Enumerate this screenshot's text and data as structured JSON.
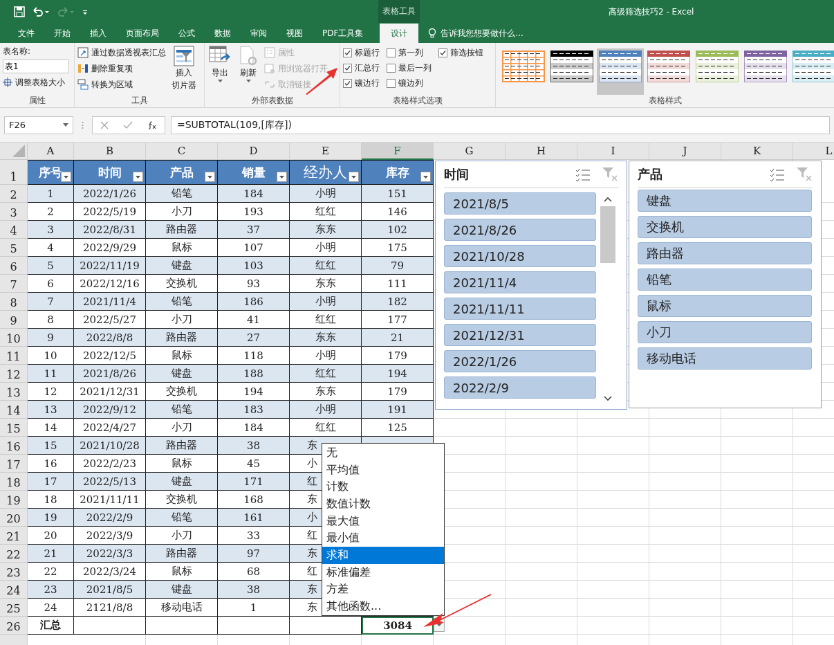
{
  "window": {
    "title": "高级筛选技巧2 - Excel",
    "contextual_tab": "表格工具"
  },
  "tabs": [
    {
      "label": "文件",
      "selected": false
    },
    {
      "label": "开始",
      "selected": false
    },
    {
      "label": "插入",
      "selected": false
    },
    {
      "label": "页面布局",
      "selected": false
    },
    {
      "label": "公式",
      "selected": false
    },
    {
      "label": "数据",
      "selected": false
    },
    {
      "label": "审阅",
      "selected": false
    },
    {
      "label": "视图",
      "selected": false
    },
    {
      "label": "PDF工具集",
      "selected": false
    },
    {
      "label": "设计",
      "selected": true
    }
  ],
  "tell_me": "告诉我您想要做什么...",
  "ribbon": {
    "properties": {
      "name_label": "表名称:",
      "name_value": "表1",
      "resize": "调整表格大小",
      "group": "属性"
    },
    "tools": {
      "items": [
        "通过数据透视表汇总",
        "删除重复项",
        "转换为区域"
      ],
      "slicer": [
        "插入",
        "切片器"
      ],
      "group": "工具"
    },
    "external": {
      "export": "导出",
      "refresh": "刷新",
      "small": [
        {
          "label": "属性",
          "disabled": true
        },
        {
          "label": "用浏览器打开",
          "disabled": true
        },
        {
          "label": "取消链接",
          "disabled": true
        }
      ],
      "group": "外部表数据"
    },
    "options": {
      "checks": [
        [
          {
            "label": "标题行",
            "checked": true
          },
          {
            "label": "汇总行",
            "checked": true
          },
          {
            "label": "镶边行",
            "checked": true
          }
        ],
        [
          {
            "label": "第一列",
            "checked": false
          },
          {
            "label": "最后一列",
            "checked": false
          },
          {
            "label": "镶边列",
            "checked": false
          }
        ],
        [
          {
            "label": "筛选按钮",
            "checked": true
          }
        ]
      ],
      "group": "表格样式选项"
    },
    "styles": {
      "swatches": [
        {
          "kind": "grid",
          "color": "#f79646",
          "selected": false
        },
        {
          "kind": "banded",
          "color": "#000000",
          "selected": false
        },
        {
          "kind": "banded",
          "color": "#4f81bd",
          "selected": true
        },
        {
          "kind": "banded",
          "color": "#c0504d",
          "selected": false
        },
        {
          "kind": "banded",
          "color": "#9bbb59",
          "selected": false
        },
        {
          "kind": "banded",
          "color": "#8064a2",
          "selected": false
        },
        {
          "kind": "banded",
          "color": "#4bacc6",
          "selected": false
        }
      ],
      "group": "表格样式"
    }
  },
  "formula_bar": {
    "name_box": "F26",
    "formula": "=SUBTOTAL(109,[库存])"
  },
  "columns": [
    {
      "label": "A",
      "selected": false
    },
    {
      "label": "B",
      "selected": false
    },
    {
      "label": "C",
      "selected": false
    },
    {
      "label": "D",
      "selected": false
    },
    {
      "label": "E",
      "selected": false
    },
    {
      "label": "F",
      "selected": true
    },
    {
      "label": "G",
      "selected": false
    },
    {
      "label": "H",
      "selected": false
    },
    {
      "label": "I",
      "selected": false
    },
    {
      "label": "J",
      "selected": false
    },
    {
      "label": "K",
      "selected": false
    },
    {
      "label": "L",
      "selected": false
    }
  ],
  "row_headers": [
    "1",
    "2",
    "3",
    "4",
    "5",
    "6",
    "7",
    "8",
    "9",
    "10",
    "11",
    "12",
    "13",
    "14",
    "15",
    "16",
    "17",
    "18",
    "19",
    "20",
    "21",
    "22",
    "23",
    "24",
    "25",
    "26"
  ],
  "table": {
    "headers": [
      "序号",
      "时间",
      "产品",
      "销量",
      "经办人",
      "库存"
    ],
    "rows": [
      [
        "1",
        "2022/1/26",
        "铅笔",
        "184",
        "小明",
        "151"
      ],
      [
        "2",
        "2022/5/19",
        "小刀",
        "193",
        "红红",
        "146"
      ],
      [
        "3",
        "2022/8/31",
        "路由器",
        "37",
        "东东",
        "102"
      ],
      [
        "4",
        "2022/9/29",
        "鼠标",
        "107",
        "小明",
        "175"
      ],
      [
        "5",
        "2022/11/19",
        "键盘",
        "103",
        "红红",
        "79"
      ],
      [
        "6",
        "2022/12/16",
        "交换机",
        "93",
        "东东",
        "111"
      ],
      [
        "7",
        "2021/11/4",
        "铅笔",
        "186",
        "小明",
        "182"
      ],
      [
        "8",
        "2022/5/27",
        "小刀",
        "41",
        "红红",
        "177"
      ],
      [
        "9",
        "2022/8/8",
        "路由器",
        "27",
        "东东",
        "21"
      ],
      [
        "10",
        "2022/12/5",
        "鼠标",
        "118",
        "小明",
        "179"
      ],
      [
        "11",
        "2021/8/26",
        "键盘",
        "188",
        "红红",
        "194"
      ],
      [
        "12",
        "2021/12/31",
        "交换机",
        "194",
        "东东",
        "179"
      ],
      [
        "13",
        "2022/9/12",
        "铅笔",
        "183",
        "小明",
        "191"
      ],
      [
        "14",
        "2022/4/27",
        "小刀",
        "184",
        "红红",
        "125"
      ],
      [
        "15",
        "2021/10/28",
        "路由器",
        "38",
        "东",
        ""
      ],
      [
        "16",
        "2022/2/23",
        "鼠标",
        "45",
        "小",
        ""
      ],
      [
        "17",
        "2022/5/13",
        "键盘",
        "171",
        "红",
        ""
      ],
      [
        "18",
        "2021/11/11",
        "交换机",
        "168",
        "东",
        ""
      ],
      [
        "19",
        "2022/2/9",
        "铅笔",
        "161",
        "小",
        ""
      ],
      [
        "20",
        "2022/3/9",
        "小刀",
        "33",
        "红",
        ""
      ],
      [
        "21",
        "2022/3/3",
        "路由器",
        "97",
        "东",
        ""
      ],
      [
        "22",
        "2022/3/24",
        "鼠标",
        "68",
        "红",
        ""
      ],
      [
        "23",
        "2021/8/5",
        "键盘",
        "38",
        "东",
        ""
      ],
      [
        "24",
        "2121/8/8",
        "移动电话",
        "1",
        "东",
        ""
      ]
    ],
    "total_label": "汇总",
    "total_value": "3084"
  },
  "slicers": [
    {
      "title": "时间",
      "items": [
        {
          "label": "2021/8/5",
          "selected": true
        },
        {
          "label": "2021/8/26",
          "selected": true
        },
        {
          "label": "2021/10/28",
          "selected": true
        },
        {
          "label": "2021/11/4",
          "selected": true
        },
        {
          "label": "2021/11/11",
          "selected": true
        },
        {
          "label": "2021/12/31",
          "selected": true
        },
        {
          "label": "2022/1/26",
          "selected": true
        },
        {
          "label": "2022/2/9",
          "selected": true
        }
      ],
      "scrollbar": true
    },
    {
      "title": "产品",
      "items": [
        {
          "label": "键盘",
          "selected": true
        },
        {
          "label": "交换机",
          "selected": true
        },
        {
          "label": "路由器",
          "selected": true
        },
        {
          "label": "铅笔",
          "selected": true
        },
        {
          "label": "鼠标",
          "selected": true
        },
        {
          "label": "小刀",
          "selected": true
        },
        {
          "label": "移动电话",
          "selected": true
        }
      ],
      "scrollbar": false
    }
  ],
  "total_menu": [
    {
      "label": "无",
      "selected": false
    },
    {
      "label": "平均值",
      "selected": false
    },
    {
      "label": "计数",
      "selected": false
    },
    {
      "label": "数值计数",
      "selected": false
    },
    {
      "label": "最大值",
      "selected": false
    },
    {
      "label": "最小值",
      "selected": false
    },
    {
      "label": "求和",
      "selected": true
    },
    {
      "label": "标准偏差",
      "selected": false
    },
    {
      "label": "方差",
      "selected": false
    },
    {
      "label": "其他函数...",
      "selected": false
    }
  ]
}
